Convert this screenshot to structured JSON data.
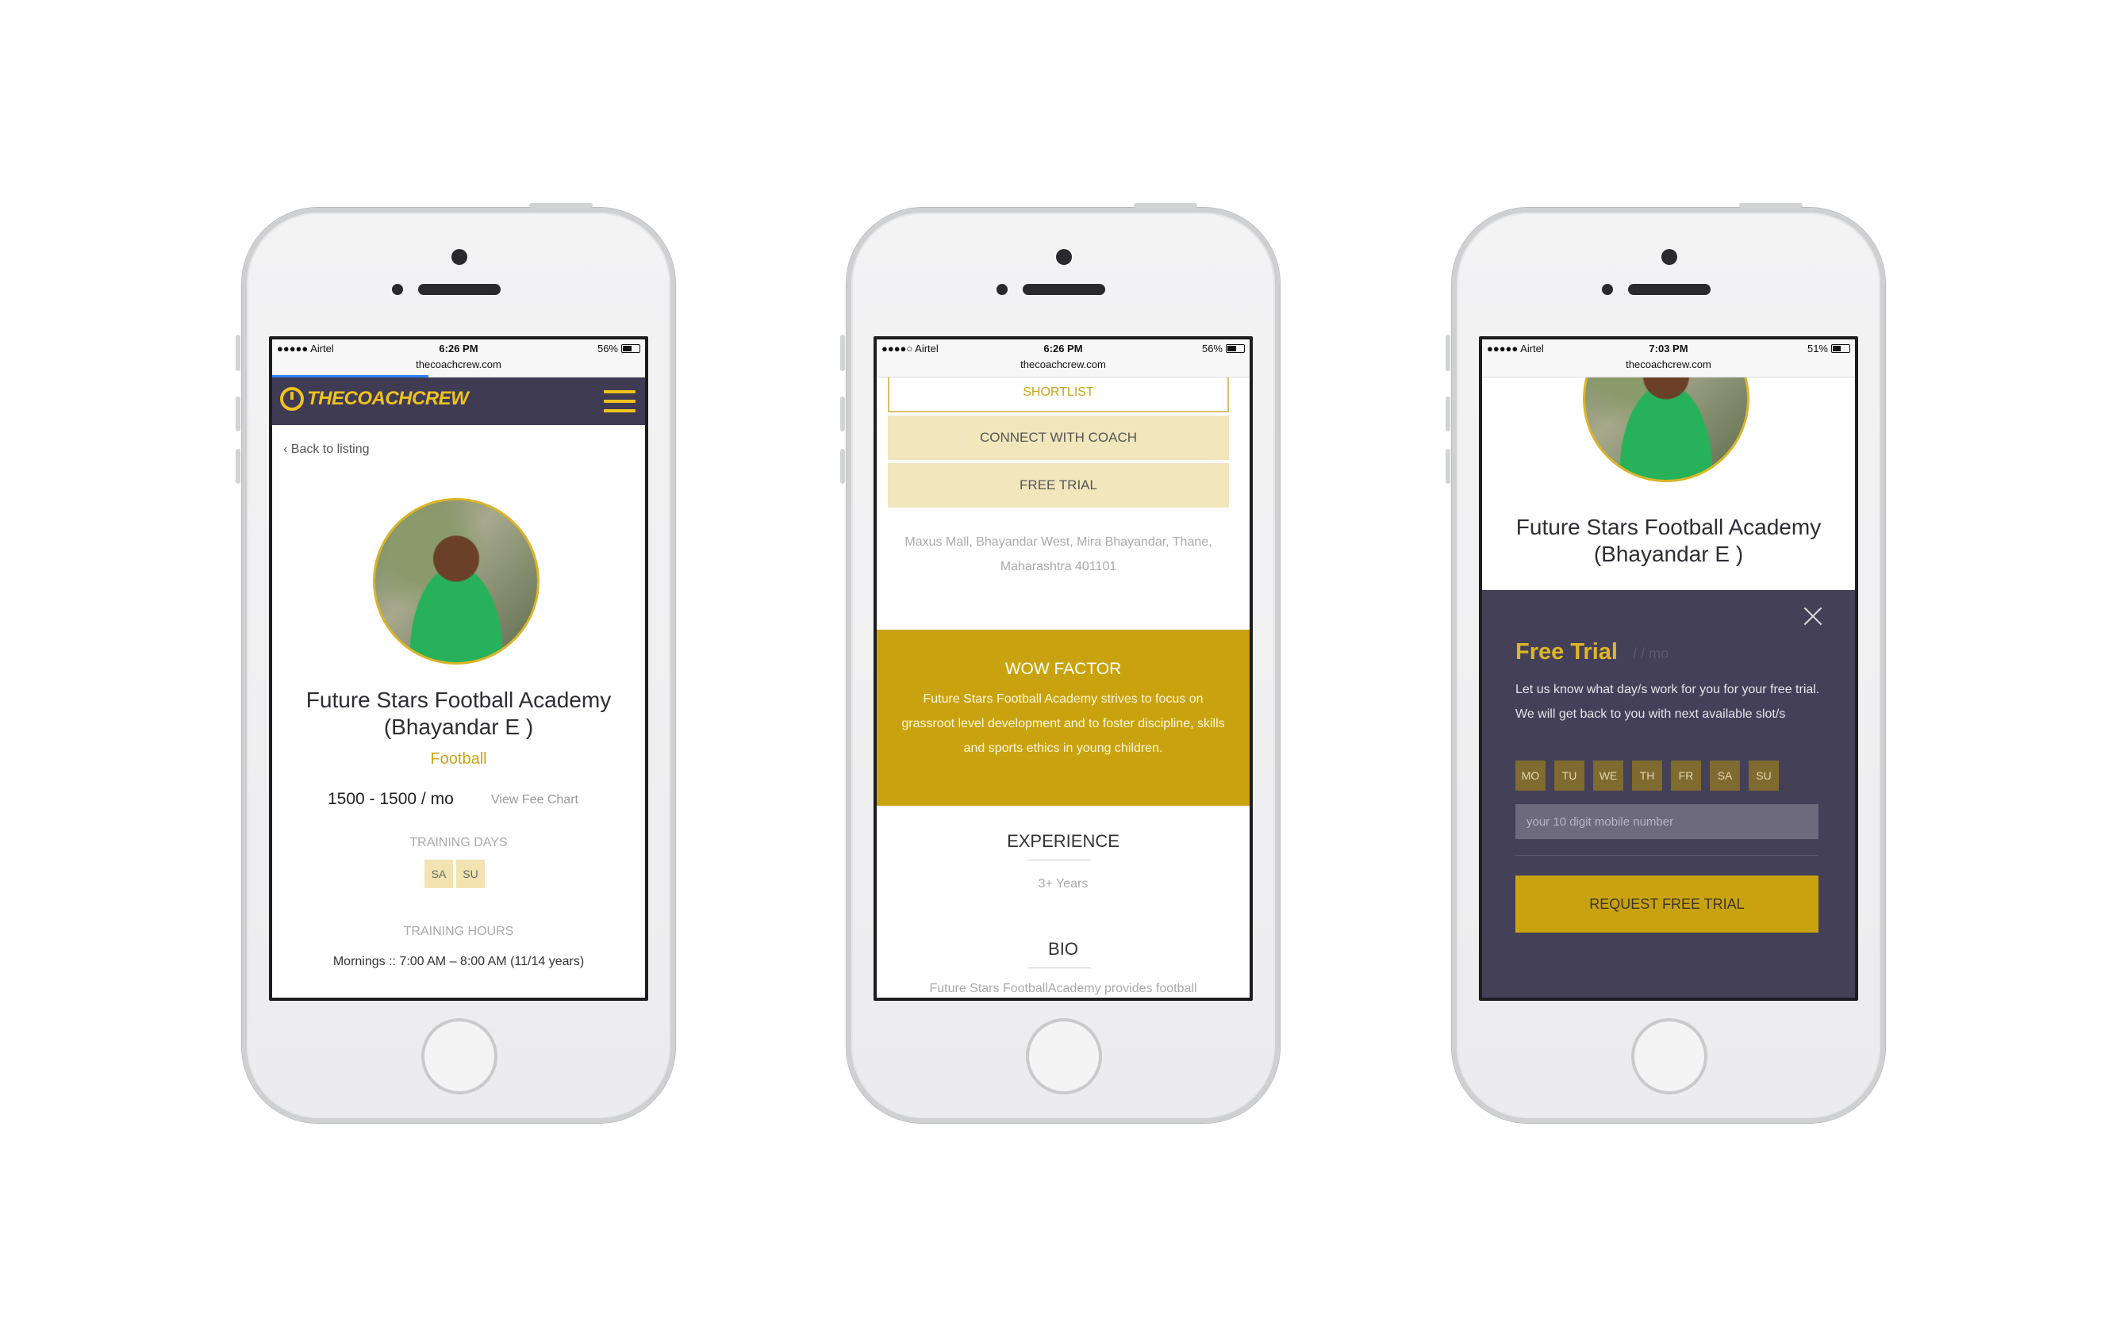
{
  "phones": [
    {
      "status": {
        "carrier": "●●●●● Airtel",
        "time": "6:26 PM",
        "battery": "56%",
        "battery_level": 0.56
      },
      "url": "thecoachcrew.com",
      "load_progress": 0.42,
      "logo": {
        "part1": "THECOACH",
        "part2": "CREW"
      },
      "back": "‹  Back to listing",
      "academy": {
        "line1": "Future Stars Football Academy",
        "line2": "(Bhayandar E )"
      },
      "sport": "Football",
      "fee": "1500 - 1500 / mo",
      "fee_chart": "View Fee Chart",
      "training_days_label": "TRAINING DAYS",
      "training_days": [
        "SA",
        "SU"
      ],
      "training_hours_label": "TRAINING HOURS",
      "training_hours": "Mornings :: 7:00 AM – 8:00 AM (11/14 years)"
    },
    {
      "status": {
        "carrier": "●●●●○ Airtel",
        "time": "6:26 PM",
        "battery": "56%",
        "battery_level": 0.56
      },
      "url": "thecoachcrew.com",
      "buttons": {
        "shortlist": "SHORTLIST",
        "connect": "CONNECT WITH COACH",
        "free_trial": "FREE TRIAL"
      },
      "address": "Maxus Mall, Bhayandar West, Mira Bhayandar, Thane, Maharashtra 401101",
      "wow": {
        "title": "WOW FACTOR",
        "text": "Future Stars Football Academy strives to focus on grassroot level development and to foster discipline, skills and sports ethics in young children."
      },
      "experience": {
        "title": "EXPERIENCE",
        "value": "3+ Years"
      },
      "bio": {
        "title": "BIO",
        "text": "Future Stars FootballAcademy provides football"
      }
    },
    {
      "status": {
        "carrier": "●●●●● Airtel",
        "time": "7:03 PM",
        "battery": "51%",
        "battery_level": 0.51
      },
      "url": "thecoachcrew.com",
      "academy": {
        "line1": "Future Stars Football Academy",
        "line2": "(Bhayandar E )"
      },
      "modal": {
        "title": "Free Trial",
        "subtitle": "/ / mo",
        "description": "Let us know what day/s work for you for your free trial. We will get back to you with next available slot/s",
        "days": [
          "MO",
          "TU",
          "WE",
          "TH",
          "FR",
          "SA",
          "SU"
        ],
        "mobile_placeholder": "your 10 digit mobile number",
        "request_button": "REQUEST FREE TRIAL"
      }
    }
  ],
  "colors": {
    "nav": "#3e3b53",
    "accent": "#c9a30f",
    "modal": "#434058"
  }
}
